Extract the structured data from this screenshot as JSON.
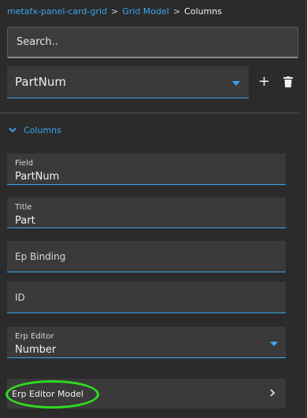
{
  "breadcrumb": {
    "items": [
      "metafx-panel-card-grid",
      "Grid Model",
      "Columns"
    ],
    "separator": ">"
  },
  "search": {
    "placeholder": "Search.."
  },
  "column_selector": {
    "value": "PartNum"
  },
  "actions": {
    "add_symbol": "+",
    "add_icon": "plus-icon",
    "delete_icon": "trash-icon"
  },
  "section": {
    "title": "Columns",
    "icon": "chevron-down-icon"
  },
  "fields": {
    "field": {
      "label": "Field",
      "value": "PartNum"
    },
    "title": {
      "label": "Title",
      "value": "Part"
    },
    "ep_binding": {
      "label": "Ep Binding",
      "value": ""
    },
    "id": {
      "label": "ID",
      "value": ""
    },
    "erp_editor": {
      "label": "Erp Editor",
      "value": "Number"
    }
  },
  "erp_editor_model": {
    "label": "Erp Editor Model",
    "icon": "chevron-right-icon"
  },
  "colors": {
    "accent": "#3aa5ef",
    "background": "#2b2b2b",
    "field_background": "#3a3a3a",
    "highlight": "#2fdc1f"
  }
}
